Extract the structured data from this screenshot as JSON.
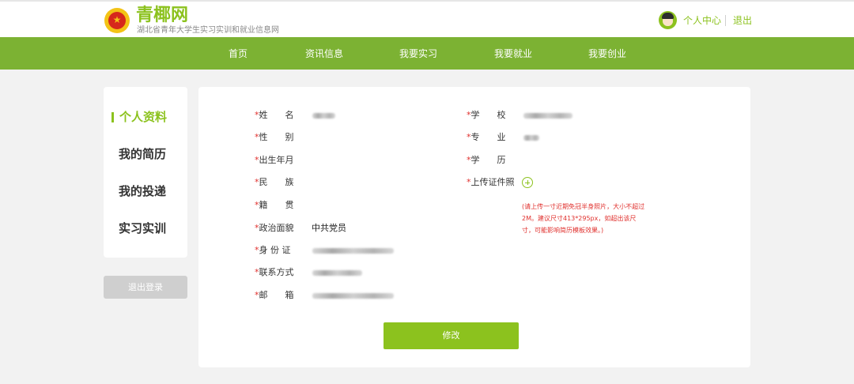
{
  "brand": {
    "name": "青椰网",
    "subtitle": "湖北省青年大学生实习实训和就业信息网",
    "logo_icon": "youth-league-emblem"
  },
  "header": {
    "user_center": "个人中心",
    "logout": "退出",
    "avatar_icon": "user-avatar"
  },
  "nav": {
    "items": [
      "首页",
      "资讯信息",
      "我要实习",
      "我要就业",
      "我要创业"
    ]
  },
  "sidebar": {
    "items": [
      "个人资料",
      "我的简历",
      "我的投递",
      "实习实训"
    ],
    "active": "个人资料",
    "logout_button": "退出登录"
  },
  "form": {
    "required_mark": "*",
    "left_fields": [
      {
        "label": "姓　　名",
        "value": ""
      },
      {
        "label": "性　　别",
        "value": ""
      },
      {
        "label": "出生年月",
        "value": ""
      },
      {
        "label": "民　　族",
        "value": ""
      },
      {
        "label": "籍　　贯",
        "value": ""
      },
      {
        "label": "政治面貌",
        "value": "中共党员"
      },
      {
        "label": "身 份 证",
        "value": ""
      },
      {
        "label": "联系方式",
        "value": ""
      },
      {
        "label": "邮　　箱",
        "value": ""
      }
    ],
    "right_fields": [
      {
        "label": "学　　校",
        "value": ""
      },
      {
        "label": "专　　业",
        "value": ""
      },
      {
        "label": "学　　历",
        "value": ""
      },
      {
        "label": "上传证件照",
        "value": ""
      }
    ],
    "upload_icon": "plus-circle-icon",
    "photo_note": "(请上传一寸近期免冠半身照片，大小不超过2M。建议尺寸413*295px，如超出该尺寸，可能影响简历模板效果。)",
    "submit_label": "修改"
  },
  "colors": {
    "accent": "#8cc21e",
    "nav_background": "#7cb233",
    "required": "#e0312e",
    "page_background": "#f2f2f2"
  }
}
